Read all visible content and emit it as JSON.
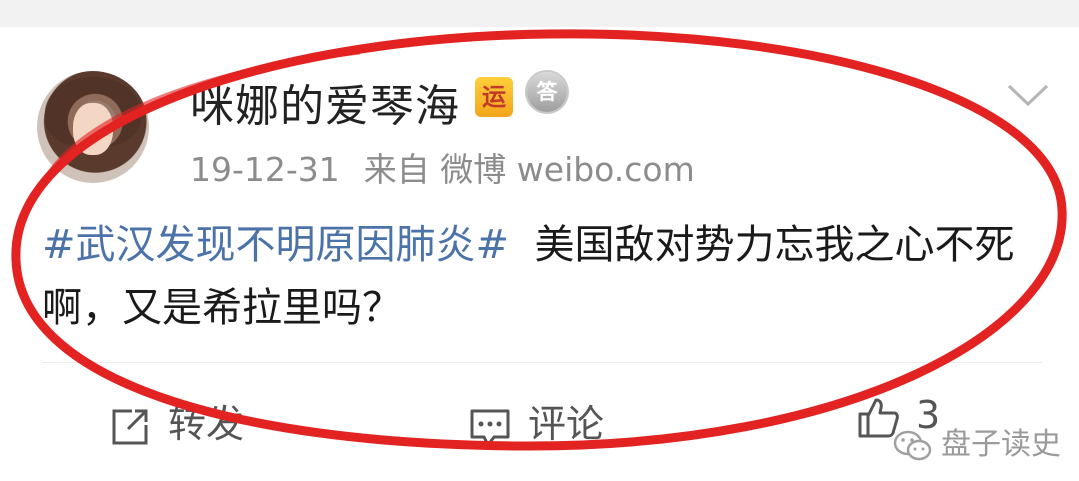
{
  "user": {
    "name": "咪娜的爱琴海",
    "badge_yun": "运",
    "badge_da": "答"
  },
  "meta": {
    "date": "19-12-31",
    "source": "来自 微博 weibo.com"
  },
  "post": {
    "hashtag": "#武汉发现不明原因肺炎#",
    "text": "美国敌对势力忘我之心不死啊，又是希拉里吗？"
  },
  "actions": {
    "repost_label": "转发",
    "comment_label": "评论",
    "like_count": "3"
  },
  "watermark": {
    "text": "盘子读史"
  },
  "colors": {
    "hashtag": "#4c73a9",
    "annotation_oval": "#e32222"
  }
}
